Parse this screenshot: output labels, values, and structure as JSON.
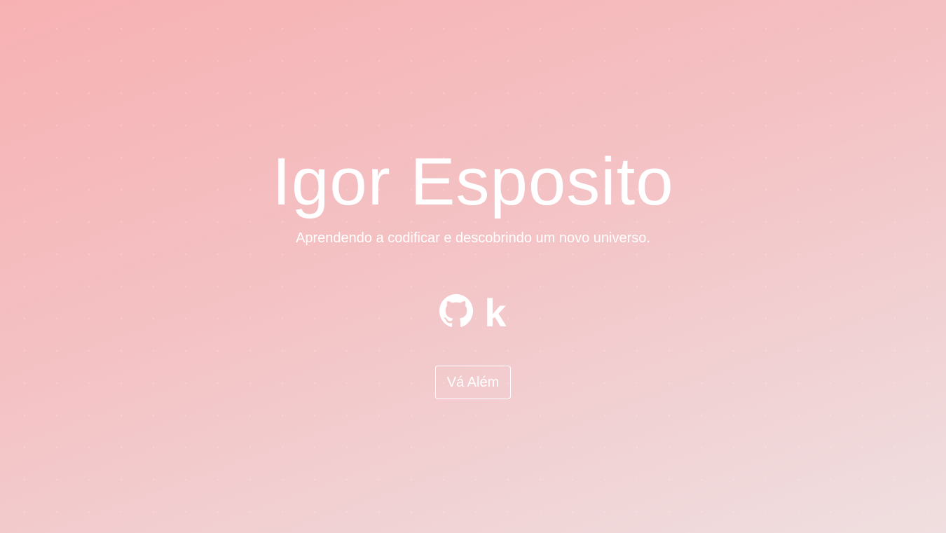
{
  "hero": {
    "name": "Igor Esposito",
    "tagline": "Aprendendo a codificar e descobrindo um novo universo."
  },
  "socials": [
    {
      "icon": "github-icon"
    },
    {
      "icon": "k-icon",
      "glyph": "k"
    }
  ],
  "cta": {
    "label": "Vá Além"
  },
  "colors": {
    "gradient_start": "#f7b1b3",
    "gradient_end": "#f0dfe0",
    "text": "#ffffff"
  }
}
